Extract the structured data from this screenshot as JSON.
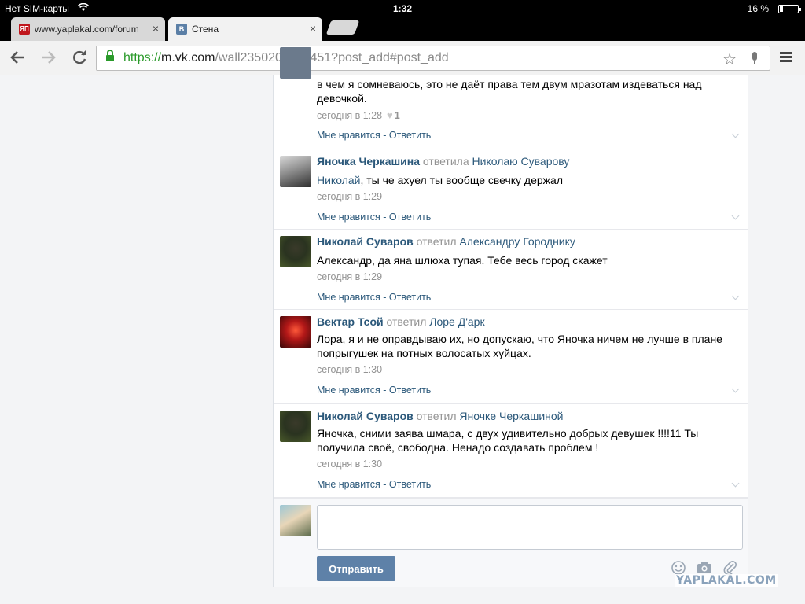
{
  "status_bar": {
    "carrier": "Нет SIM-карты",
    "time": "1:32",
    "battery": "16 %",
    "battery_level": 0.16
  },
  "tabs": [
    {
      "title": "www.yaplakal.com/forum",
      "favicon": "ЯП",
      "favicon_color": "#c0161c",
      "active": false,
      "close": "×"
    },
    {
      "title": "Стена",
      "favicon": "B",
      "favicon_color": "#5b7fa6",
      "active": true,
      "close": "×"
    }
  ],
  "toolbar": {
    "url_scheme": "https://",
    "url_host": "m.vk.com",
    "url_path": "/wall235020923_451?post_add#post_add",
    "icons": {
      "back": "back-arrow-icon",
      "forward": "forward-arrow-icon",
      "reload": "reload-icon",
      "bookmark": "star-icon",
      "voice": "microphone-icon",
      "menu": "menu-icon"
    }
  },
  "comments": [
    {
      "author": "",
      "verb": "",
      "target": "",
      "mention": "",
      "text": "в чем я сомневаюсь, это не даёт права тем двум мразотам издеваться над девочкой.",
      "time": "сегодня в 1:28",
      "likes": "1",
      "actions": "Мне нравится - Ответить"
    },
    {
      "author": "Яночка Черкашина",
      "verb": "ответила",
      "target": "Николаю Суварову",
      "mention": "Николай",
      "text": ", ты че ахуел ты вообще свечку держал",
      "time": "сегодня в 1:29",
      "actions": "Мне нравится - Ответить"
    },
    {
      "author": "Николай Суваров",
      "verb": "ответил",
      "target": "Александру Городнику",
      "mention": "",
      "text": "Александр, да яна шлюха тупая. Тебе весь город скажет",
      "time": "сегодня в 1:29",
      "actions": "Мне нравится - Ответить"
    },
    {
      "author": "Вектар Тсой",
      "verb": "ответил",
      "target": "Лоре Д'арк",
      "mention": "",
      "text": "Лора, я и не оправдываю их, но допускаю, что Яночка ничем не лучше в плане попрыгушек на потных волосатых хуйцах.",
      "time": "сегодня в 1:30",
      "actions": "Мне нравится - Ответить"
    },
    {
      "author": "Николай Суваров",
      "verb": "ответил",
      "target": "Яночке Черкашиной",
      "mention": "",
      "text": "Яночка, сними заява шмара, с двух удивительно добрых девушек !!!!11 Ты получила своё, свободна. Ненадо создавать проблем !",
      "time": "сегодня в 1:30",
      "actions": "Мне нравится - Ответить"
    }
  ],
  "reply": {
    "value": "",
    "send_label": "Отправить",
    "icons": [
      "smile-icon",
      "camera-icon",
      "paperclip-icon"
    ]
  },
  "watermark": "YAPLAKAL.COM",
  "colors": {
    "link": "#2b587a",
    "muted": "#939393",
    "send_button": "#5e81a8",
    "secure": "#2a9a2a"
  }
}
